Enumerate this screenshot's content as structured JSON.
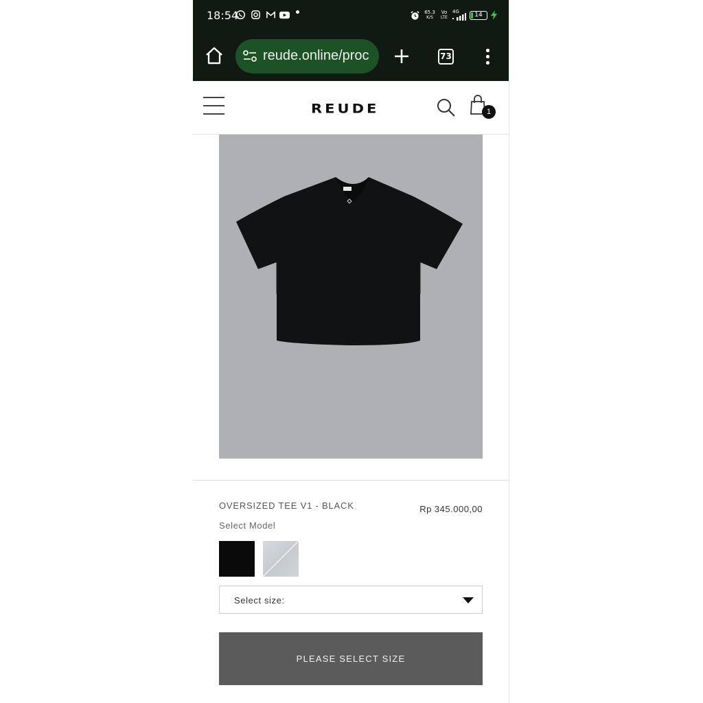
{
  "status_bar": {
    "time": "18:54",
    "notification_icons": [
      "whatsapp-icon",
      "instagram-icon",
      "gmail-icon",
      "youtube-icon"
    ],
    "network_speed_value": "65.3",
    "network_speed_unit": "K/S",
    "volte_top": "Vo",
    "volte_bottom": "LTE",
    "network_type": "4G",
    "battery_level": "14",
    "battery_fill_fraction": 0.14,
    "charging": true
  },
  "browser": {
    "url": "reude.online/proc",
    "tab_count": "73",
    "toolbar_color": "#101a12",
    "url_pill_color": "#1d5227"
  },
  "site": {
    "logo": "REUDE",
    "cart_count": "1"
  },
  "product": {
    "title": "OVERSIZED TEE V1 - BLACK",
    "price": "Rp 345.000,00",
    "select_model_label": "Select Model",
    "models": [
      {
        "name": "black",
        "color": "#0a0a0a"
      },
      {
        "name": "white",
        "color": "#d6d9dc"
      }
    ],
    "size_select_placeholder": "Select size:",
    "add_button_label": "PLEASE SELECT SIZE",
    "image_background": "#afb0b3"
  }
}
